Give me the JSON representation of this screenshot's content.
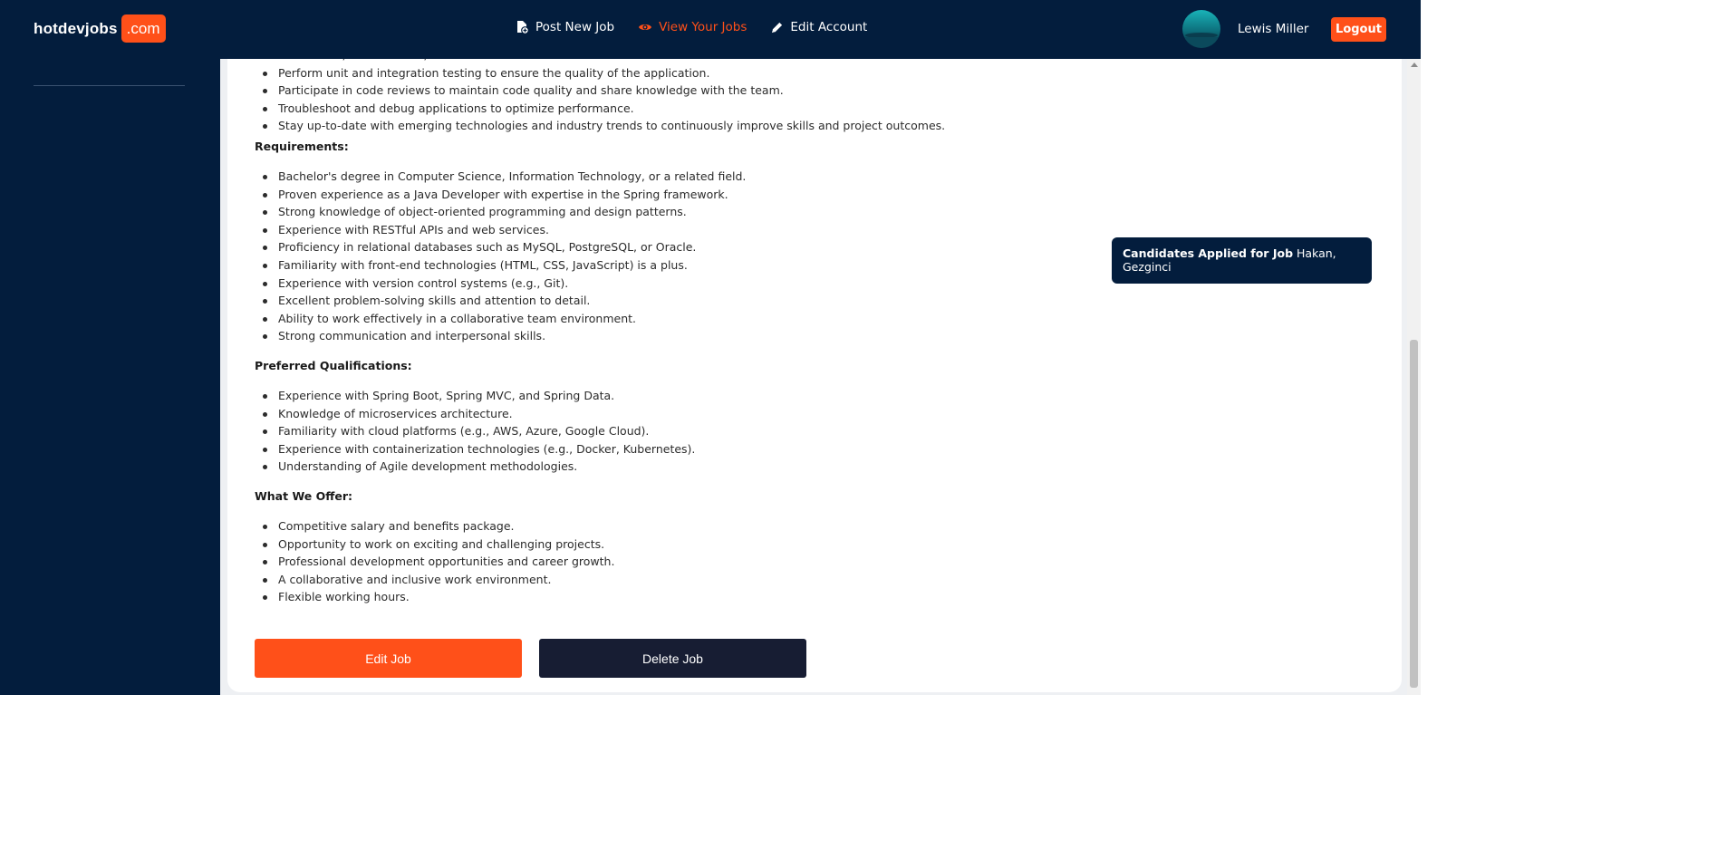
{
  "brand": {
    "name": "hotdevjobs",
    "suffix": ".com"
  },
  "nav": {
    "post_job": "Post New Job",
    "view_jobs": "View Your Jobs",
    "edit_account": "Edit Account"
  },
  "user": {
    "name": "Lewis Miller",
    "logout": "Logout"
  },
  "colors": {
    "navy": "#031d3d",
    "accent": "#ff5019",
    "dark_button": "#171d33"
  },
  "job": {
    "responsibilities": [
      "Write clean, maintainable, and efficient code.",
      "Perform unit and integration testing to ensure the quality of the application.",
      "Participate in code reviews to maintain code quality and share knowledge with the team.",
      "Troubleshoot and debug applications to optimize performance.",
      "Stay up-to-date with emerging technologies and industry trends to continuously improve skills and project outcomes."
    ],
    "requirements_title": "Requirements:",
    "requirements": [
      "Bachelor's degree in Computer Science, Information Technology, or a related field.",
      "Proven experience as a Java Developer with expertise in the Spring framework.",
      "Strong knowledge of object-oriented programming and design patterns.",
      "Experience with RESTful APIs and web services.",
      "Proficiency in relational databases such as MySQL, PostgreSQL, or Oracle.",
      "Familiarity with front-end technologies (HTML, CSS, JavaScript) is a plus.",
      "Experience with version control systems (e.g., Git).",
      "Excellent problem-solving skills and attention to detail.",
      "Ability to work effectively in a collaborative team environment.",
      "Strong communication and interpersonal skills."
    ],
    "preferred_title": "Preferred Qualifications:",
    "preferred": [
      "Experience with Spring Boot, Spring MVC, and Spring Data.",
      "Knowledge of microservices architecture.",
      "Familiarity with cloud platforms (e.g., AWS, Azure, Google Cloud).",
      "Experience with containerization technologies (e.g., Docker, Kubernetes).",
      "Understanding of Agile development methodologies."
    ],
    "offer_title": "What We Offer:",
    "offer": [
      "Competitive salary and benefits package.",
      "Opportunity to work on exciting and challenging projects.",
      "Professional development opportunities and career growth.",
      "A collaborative and inclusive work environment.",
      "Flexible working hours."
    ]
  },
  "actions": {
    "edit": "Edit Job",
    "delete": "Delete Job"
  },
  "candidates": {
    "label": "Candidates Applied for Job",
    "names": "Hakan, Gezginci"
  }
}
